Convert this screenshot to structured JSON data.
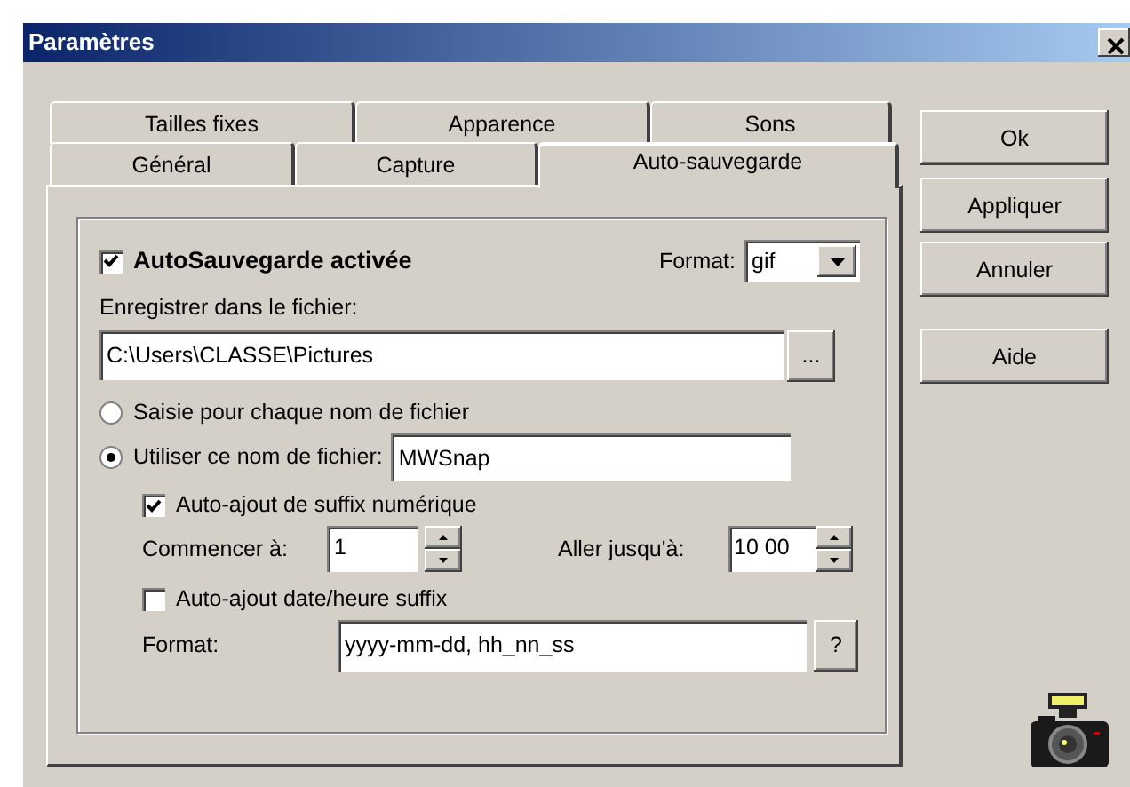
{
  "window": {
    "title": "Paramètres"
  },
  "tab_rows": [
    [
      {
        "label": "Tailles fixes",
        "selected": false
      },
      {
        "label": "Apparence",
        "selected": false
      },
      {
        "label": "Sons",
        "selected": false
      }
    ],
    [
      {
        "label": "Général",
        "selected": false
      },
      {
        "label": "Capture",
        "selected": false
      },
      {
        "label": "Auto-sauvegarde",
        "selected": true
      }
    ]
  ],
  "autosave": {
    "label": "AutoSauvegarde activée",
    "checked": true
  },
  "format": {
    "label": "Format:",
    "value": "gif"
  },
  "save_label": "Enregistrer dans le fichier:",
  "path": {
    "value": "C:\\Users\\CLASSE\\Pictures",
    "browse": "..."
  },
  "radios": [
    {
      "label": "Saisie pour chaque nom de fichier",
      "selected": false
    },
    {
      "label": "Utiliser ce nom de fichier:",
      "selected": true
    }
  ],
  "filename": {
    "value": "MWSnap"
  },
  "numeric_suffix": {
    "label": "Auto-ajout de suffix numérique",
    "checked": true
  },
  "start": {
    "label": "Commencer à:",
    "value": "1"
  },
  "end": {
    "label": "Aller jusqu'à:",
    "value": "10 00"
  },
  "date_suffix": {
    "label": "Auto-ajout date/heure suffix",
    "checked": false
  },
  "date_format": {
    "label": "Format:",
    "value": "yyyy-mm-dd, hh_nn_ss",
    "help": "?"
  },
  "buttons": [
    "Ok",
    "Appliquer",
    "Annuler",
    "Aide"
  ]
}
